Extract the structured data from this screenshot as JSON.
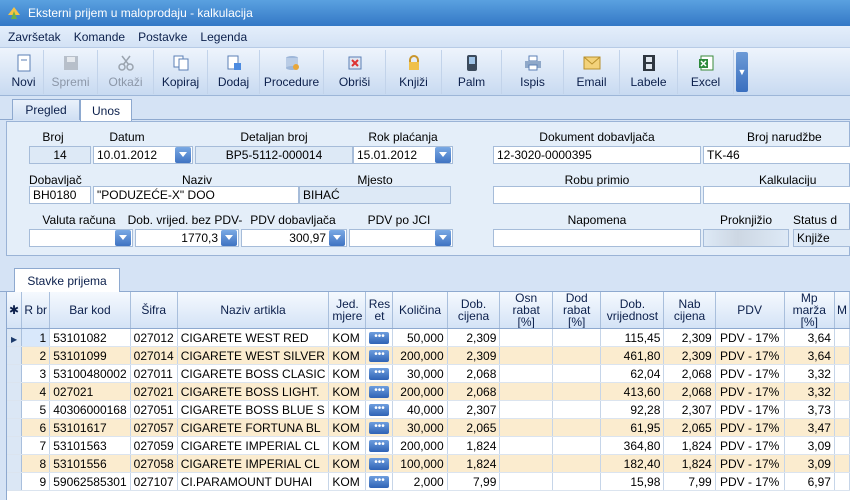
{
  "window": {
    "title": "Eksterni prijem u maloprodaju - kalkulacija"
  },
  "menu": [
    "Završetak",
    "Komande",
    "Postavke",
    "Legenda"
  ],
  "toolbar": [
    {
      "label": "Novi",
      "icon": "new-document-icon",
      "enabled": true
    },
    {
      "label": "Spremi",
      "icon": "floppy-disk-icon",
      "enabled": false
    },
    {
      "label": "Otkaži",
      "icon": "scissors-icon",
      "enabled": false
    },
    {
      "label": "Kopiraj",
      "icon": "copy-icon",
      "enabled": true
    },
    {
      "label": "Dodaj",
      "icon": "add-document-icon",
      "enabled": true
    },
    {
      "label": "Procedure",
      "icon": "database-icon",
      "enabled": true
    },
    {
      "label": "Obriši",
      "icon": "delete-icon",
      "enabled": true
    },
    {
      "label": "Knjiži",
      "icon": "lock-icon",
      "enabled": true
    },
    {
      "label": "Palm",
      "icon": "palm-device-icon",
      "enabled": true
    },
    {
      "label": "Ispis",
      "icon": "printer-icon",
      "enabled": true
    },
    {
      "label": "Email",
      "icon": "email-icon",
      "enabled": true
    },
    {
      "label": "Labele",
      "icon": "film-icon",
      "enabled": true
    },
    {
      "label": "Excel",
      "icon": "excel-icon",
      "enabled": true
    }
  ],
  "tabs": [
    {
      "label": "Pregled",
      "active": false
    },
    {
      "label": "Unos",
      "active": true
    }
  ],
  "form": {
    "broj": {
      "label": "Broj",
      "value": "14"
    },
    "datum": {
      "label": "Datum",
      "value": "10.01.2012"
    },
    "detaljan_broj": {
      "label": "Detaljan broj",
      "value": "BP5-5112-000014"
    },
    "rok_placanja": {
      "label": "Rok plaćanja",
      "value": "15.01.2012"
    },
    "dokument_dobavljaca": {
      "label": "Dokument dobavljača",
      "value": "12-3020-0000395"
    },
    "broj_narudzbe": {
      "label": "Broj narudžbe",
      "value": "TK-46"
    },
    "dobavljac": {
      "label": "Dobavljač",
      "value": "BH0180"
    },
    "naziv": {
      "label": "Naziv",
      "value": "\"PODUZEĆE-X\" DOO"
    },
    "mjesto": {
      "label": "Mjesto",
      "value": "BIHAĆ"
    },
    "robu_primio": {
      "label": "Robu primio",
      "value": ""
    },
    "kalkulaciju_odradio": {
      "label": "Kalkulaciju odradi",
      "value": ""
    },
    "valuta_racuna": {
      "label": "Valuta računa",
      "value": ""
    },
    "dob_vrijednost": {
      "label": "Dob. vrijed. bez PDV-a",
      "value": "1770,3"
    },
    "pdv_dobavljaca": {
      "label": "PDV dobavljača",
      "value": "300,97"
    },
    "pdv_po_jci": {
      "label": "PDV po JCI",
      "value": ""
    },
    "napomena": {
      "label": "Napomena",
      "value": ""
    },
    "proknjizio": {
      "label": "Proknjižio",
      "value": ""
    },
    "status": {
      "label": "Status d",
      "value": "Knjiže"
    }
  },
  "subtab": {
    "label": "Stavke prijema"
  },
  "grid": {
    "columns": [
      "R br",
      "Bar kod",
      "Šifra",
      "Naziv artikla",
      "Jed. mjere",
      "Res et",
      "Količina",
      "Dob. cijena",
      "Osn rabat [%]",
      "Dod rabat [%]",
      "Dob. vrijednost",
      "Nab cijena",
      "PDV",
      "Mp marža [%]",
      "M"
    ],
    "rows": [
      [
        "1",
        "53101082",
        "027012",
        "CIGARETE WEST RED",
        "KOM",
        "",
        "50,000",
        "2,309",
        "",
        "",
        "115,45",
        "2,309",
        "PDV - 17%",
        "3,64"
      ],
      [
        "2",
        "53101099",
        "027014",
        "CIGARETE WEST SILVER",
        "KOM",
        "",
        "200,000",
        "2,309",
        "",
        "",
        "461,80",
        "2,309",
        "PDV - 17%",
        "3,64"
      ],
      [
        "3",
        "53100480002",
        "027011",
        "CIGARETE BOSS CLASIC",
        "KOM",
        "",
        "30,000",
        "2,068",
        "",
        "",
        "62,04",
        "2,068",
        "PDV - 17%",
        "3,32"
      ],
      [
        "4",
        "027021",
        "027021",
        "CIGARETE BOSS LIGHT.",
        "KOM",
        "",
        "200,000",
        "2,068",
        "",
        "",
        "413,60",
        "2,068",
        "PDV - 17%",
        "3,32"
      ],
      [
        "5",
        "40306000168",
        "027051",
        "CIGARETE BOSS BLUE S",
        "KOM",
        "",
        "40,000",
        "2,307",
        "",
        "",
        "92,28",
        "2,307",
        "PDV - 17%",
        "3,73"
      ],
      [
        "6",
        "53101617",
        "027057",
        "CIGARETE FORTUNA BL",
        "KOM",
        "",
        "30,000",
        "2,065",
        "",
        "",
        "61,95",
        "2,065",
        "PDV - 17%",
        "3,47"
      ],
      [
        "7",
        "53101563",
        "027059",
        "CIGARETE IMPERIAL CL",
        "KOM",
        "",
        "200,000",
        "1,824",
        "",
        "",
        "364,80",
        "1,824",
        "PDV - 17%",
        "3,09"
      ],
      [
        "8",
        "53101556",
        "027058",
        "CIGARETE IMPERIAL CL",
        "KOM",
        "",
        "100,000",
        "1,824",
        "",
        "",
        "182,40",
        "1,824",
        "PDV - 17%",
        "3,09"
      ],
      [
        "9",
        "59062585301",
        "027107",
        "CI.PARAMOUNT DUHAI",
        "KOM",
        "",
        "2,000",
        "7,99",
        "",
        "",
        "15,98",
        "7,99",
        "PDV - 17%",
        "6,97"
      ]
    ]
  }
}
